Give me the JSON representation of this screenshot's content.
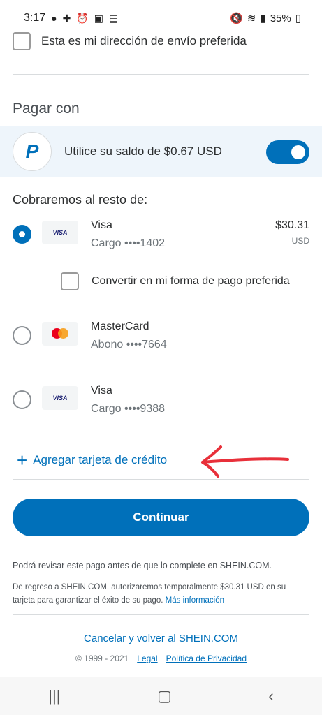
{
  "status_bar": {
    "time": "3:17",
    "battery": "35%"
  },
  "shipping": {
    "preferred_label": "Esta es mi dirección de envío preferida"
  },
  "pay_with": {
    "title": "Pagar con",
    "balance_text": "Utilice su saldo de $0.67 USD",
    "balance_enabled": true
  },
  "charge": {
    "title": "Cobraremos al resto de:",
    "cards": [
      {
        "brand_badge": "VISA",
        "name": "Visa",
        "type_number": "Cargo ••••1402",
        "amount": "$30.31",
        "currency": "USD",
        "selected": true
      },
      {
        "brand_badge": "mastercard",
        "name": "MasterCard",
        "type_number": "Abono ••••7664",
        "selected": false
      },
      {
        "brand_badge": "VISA",
        "name": "Visa",
        "type_number": "Cargo ••••9388",
        "selected": false
      }
    ],
    "convert_label": "Convertir en mi forma de pago preferida",
    "add_card_label": "Agregar tarjeta de crédito"
  },
  "actions": {
    "continue_label": "Continuar"
  },
  "notes": {
    "review": "Podrá revisar este pago antes de que lo complete en SHEIN.COM.",
    "authorize": "De regreso a SHEIN.COM, autorizaremos temporalmente $30.31 USD en su tarjeta para garantizar el éxito de su pago.",
    "more_info": "Más información"
  },
  "footer": {
    "cancel_link": "Cancelar y volver al SHEIN.COM",
    "copyright": "© 1999 - 2021",
    "legal": "Legal",
    "privacy": "Política de Privacidad"
  },
  "icons": {
    "nav_recent": "recent-apps-icon",
    "nav_home": "home-icon",
    "nav_back": "back-icon"
  },
  "colors": {
    "accent": "#0070ba",
    "annotation_arrow": "#e8303a"
  }
}
